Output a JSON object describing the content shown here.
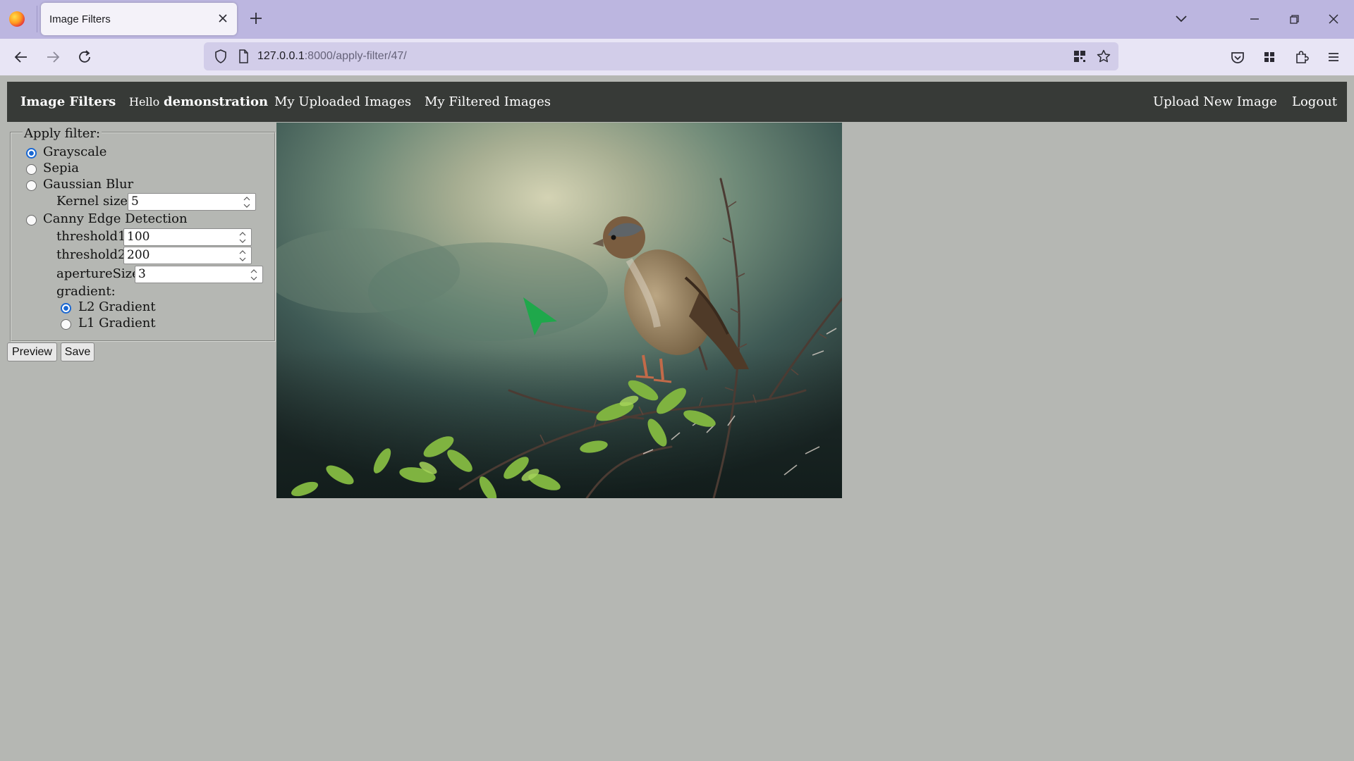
{
  "browser": {
    "tab_title": "Image Filters",
    "url_host": "127.0.0.1",
    "url_rest": ":8000/apply-filter/47/"
  },
  "nav": {
    "brand": "Image Filters",
    "greeting": "Hello",
    "username": "demonstration",
    "uploaded": "My Uploaded Images",
    "filtered": "My Filtered Images",
    "upload_new": "Upload New Image",
    "logout": "Logout"
  },
  "form": {
    "legend": "Apply filter:",
    "options": {
      "grayscale": "Grayscale",
      "sepia": "Sepia",
      "gaussian": "Gaussian Blur",
      "canny": "Canny Edge Detection"
    },
    "selected_filter": "Grayscale",
    "kernel_label": "Kernel size:",
    "kernel_value": "5",
    "threshold1_label": "threshold1:",
    "threshold1_value": "100",
    "threshold2_label": "threshold2:",
    "threshold2_value": "200",
    "aperture_label": "apertureSize:",
    "aperture_value": "3",
    "gradient_label": "gradient:",
    "l2_label": "L2 Gradient",
    "l1_label": "L1 Gradient",
    "selected_gradient": "L2 Gradient",
    "preview_label": "Preview",
    "save_label": "Save"
  },
  "colors": {
    "page_bg": "#b5b7b3",
    "navbar_bg": "#373a37",
    "tabbar_bg": "#bcb6e0",
    "toolbar_bg": "#e8e5f5",
    "radio_accent": "#1967d2",
    "cursor_color": "#1fa84b"
  }
}
